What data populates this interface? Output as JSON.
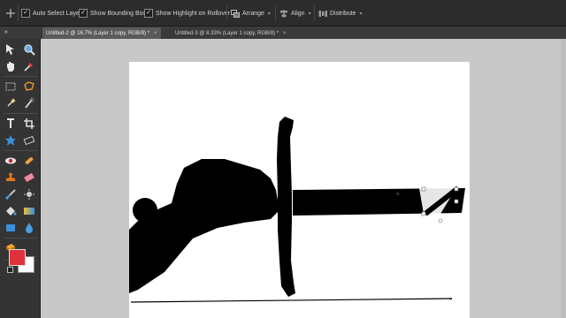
{
  "options_bar": {
    "auto_select_layer": "Auto Select Layer",
    "show_bounding_box": "Show Bounding Box",
    "show_highlight_on_rollover": "Show Highlight on Rollover",
    "arrange": "Arrange",
    "align": "Align",
    "distribute": "Distribute"
  },
  "tabs": [
    {
      "label": "Untitled-2 @ 16.7% (Layer 1 copy, RGB/8) *",
      "close": "×"
    },
    {
      "label": "Untitled-3 @ 8.33% (Layer 1 copy, RGB/8) *",
      "close": "×"
    }
  ],
  "tab_menu_icon": "«",
  "colors": {
    "foreground": "#e0323c",
    "background": "#ffffff",
    "panel": "#343434",
    "options_bar": "#2c2c2c",
    "workspace": "#c8c8c8"
  },
  "tools": [
    "move-icon",
    "zoom-icon",
    "hand-icon",
    "eyedropper-icon",
    "marquee-icon",
    "lasso-icon",
    "magic-wand-icon",
    "quick-selection-icon",
    "type-icon",
    "crop-icon",
    "cookie-cutter-icon",
    "straighten-icon",
    "red-eye-icon",
    "spot-healing-icon",
    "clone-stamp-icon",
    "eraser-icon",
    "brush-icon",
    "smart-brush-icon",
    "paint-bucket-icon",
    "gradient-icon",
    "shape-icon",
    "blur-icon",
    "sponge-icon"
  ]
}
